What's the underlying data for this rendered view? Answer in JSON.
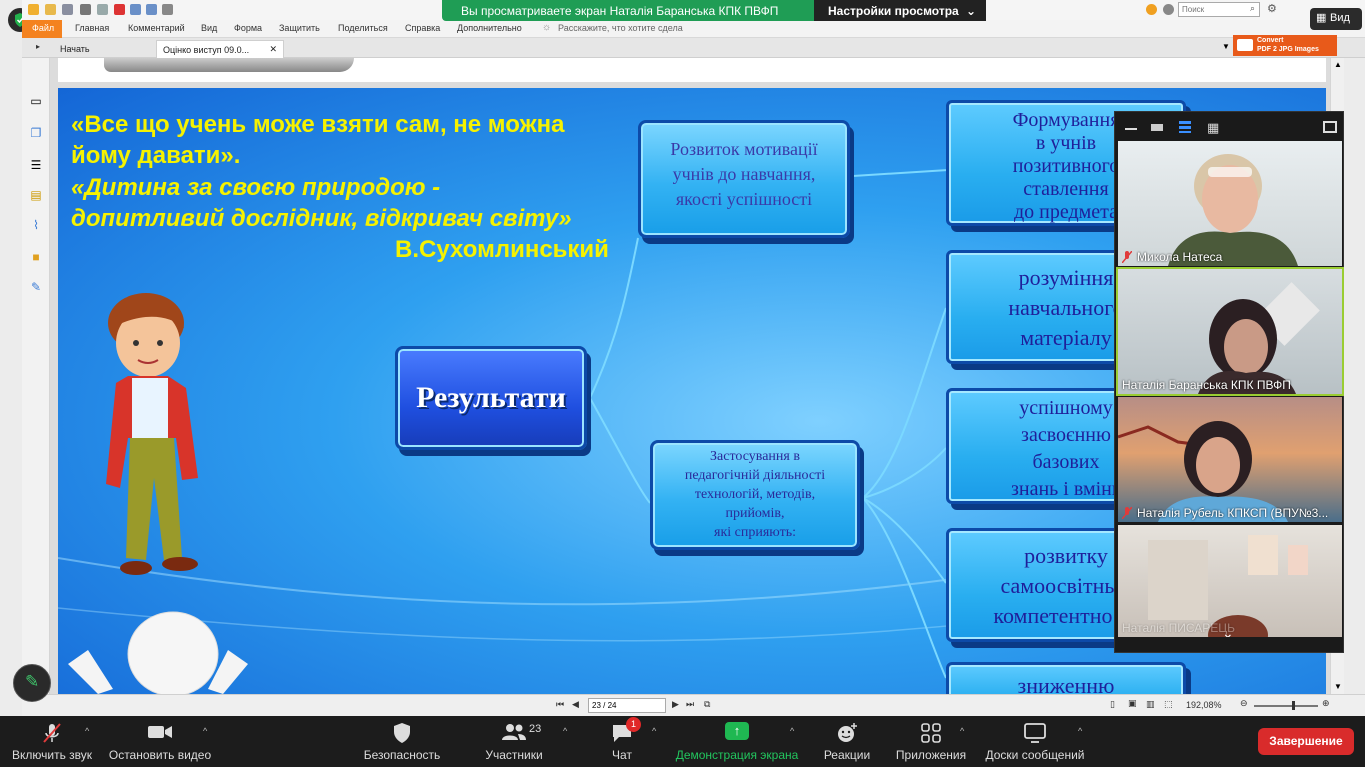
{
  "share_banner": {
    "text": "Вы просматриваете экран Наталія Баранська  КПК ПВФП",
    "view_settings": "Настройки просмотра"
  },
  "top_right": {
    "view_label": "Вид"
  },
  "foxit": {
    "ribbon_tabs": [
      "Файл",
      "Главная",
      "Комментарий",
      "Вид",
      "Форма",
      "Защитить",
      "Поделиться",
      "Справка",
      "Дополнительно"
    ],
    "tell_me": "Расскажите, что хотите сдела",
    "search_placeholder": "Поиск",
    "doc_tabs": [
      "Начать",
      "Оцiнко виступ 09.0..."
    ],
    "convert_ad": [
      "Convert",
      "PDF 2 JPG Images"
    ],
    "page_field": "23 / 24",
    "zoom": "192,08%"
  },
  "slide": {
    "quote_line1": "«Все що учень може взяти сам, не можна",
    "quote_line2": "йому давати».",
    "quote_line3": "«Дитина за своєю природою -",
    "quote_line4": "допитливий  дослідник, відкривач світу»",
    "author": "В.Сухомлинський",
    "center_box": "Результати",
    "box_motivation": [
      "Розвиток мотивації",
      "учнів до навчання,",
      "якості успішності"
    ],
    "box_application": [
      "Застосування в",
      "педагогічній діяльності",
      "технологій, методів,",
      "прийомів,",
      "які сприяють:"
    ],
    "right_boxes": [
      [
        "Формування",
        "в учнів",
        "позитивного",
        "ставлення",
        "до предмета"
      ],
      [
        "розуміння",
        "навчального",
        "матеріалу"
      ],
      [
        "успішному",
        "засвоєнню",
        "базових",
        "знань і вмінь"
      ],
      [
        "розвитку",
        "самоосвітньої",
        "компетентності"
      ],
      [
        "зниженню"
      ]
    ]
  },
  "participants": [
    {
      "name": "Микола Натеса",
      "muted": true
    },
    {
      "name": "Наталія Баранська  КПК ПВФП",
      "muted": false
    },
    {
      "name": "Наталія Рубель КПКСП (ВПУ№3...",
      "muted": true
    },
    {
      "name": "Наталія ПИСАРЕЦЬ",
      "muted": false
    }
  ],
  "toolbar": {
    "unmute": "Включить звук",
    "stop_video": "Остановить видео",
    "security": "Безопасность",
    "participants": "Участники",
    "participants_count": "23",
    "chat": "Чат",
    "chat_badge": "1",
    "share_screen": "Демонстрация экрана",
    "reactions": "Реакции",
    "apps": "Приложения",
    "whiteboards": "Доски сообщений",
    "end": "Завершение"
  }
}
